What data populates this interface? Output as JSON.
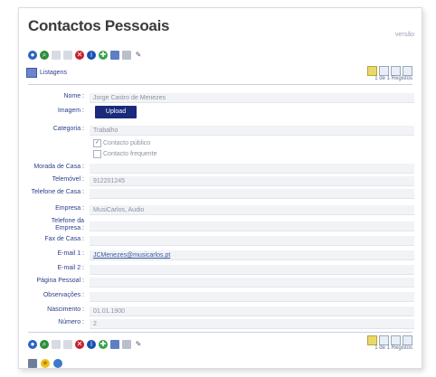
{
  "title": "Contactos Pessoais",
  "version": "versão",
  "listagens": "Listagens",
  "pager_count": "1 de 1 Registos",
  "toolbar_icons": [
    "home-icon",
    "search-icon",
    "new-icon",
    "copy-icon",
    "delete-icon",
    "info-icon",
    "refresh-icon",
    "export-icon",
    "print-icon",
    "edit-icon"
  ],
  "fields": {
    "nome": {
      "label": "Nome :",
      "value": "Jorge Castro de Menezes"
    },
    "imagem": {
      "label": "Imagem :",
      "button": "Upload"
    },
    "categoria": {
      "label": "Categoria :",
      "value": "Trabalho"
    },
    "publico": {
      "label": "Contacto público"
    },
    "frequente": {
      "label": "Contacto frequente"
    },
    "morada": {
      "label": "Morada de Casa :",
      "value": ""
    },
    "telemovel": {
      "label": "Telemóvel :",
      "value": "912201245"
    },
    "telefone_casa": {
      "label": "Telefone de Casa :",
      "value": ""
    },
    "empresa": {
      "label": "Empresa :",
      "value": "MusiCarlos, Audio"
    },
    "telefone_empresa": {
      "label": "Telefone da Empresa :",
      "value": ""
    },
    "fax": {
      "label": "Fax de Casa :",
      "value": ""
    },
    "email1": {
      "label": "E-mail 1 :",
      "value": "JCMenezes@musicarlos.pt"
    },
    "email2": {
      "label": "E-mail 2 :",
      "value": ""
    },
    "pagina": {
      "label": "Página Pessoal :",
      "value": ""
    },
    "obs": {
      "label": "Observações :",
      "value": ""
    },
    "nascimento": {
      "label": "Nascimento :",
      "value": "01.01.1900"
    },
    "numero": {
      "label": "Número :",
      "value": "2"
    }
  }
}
